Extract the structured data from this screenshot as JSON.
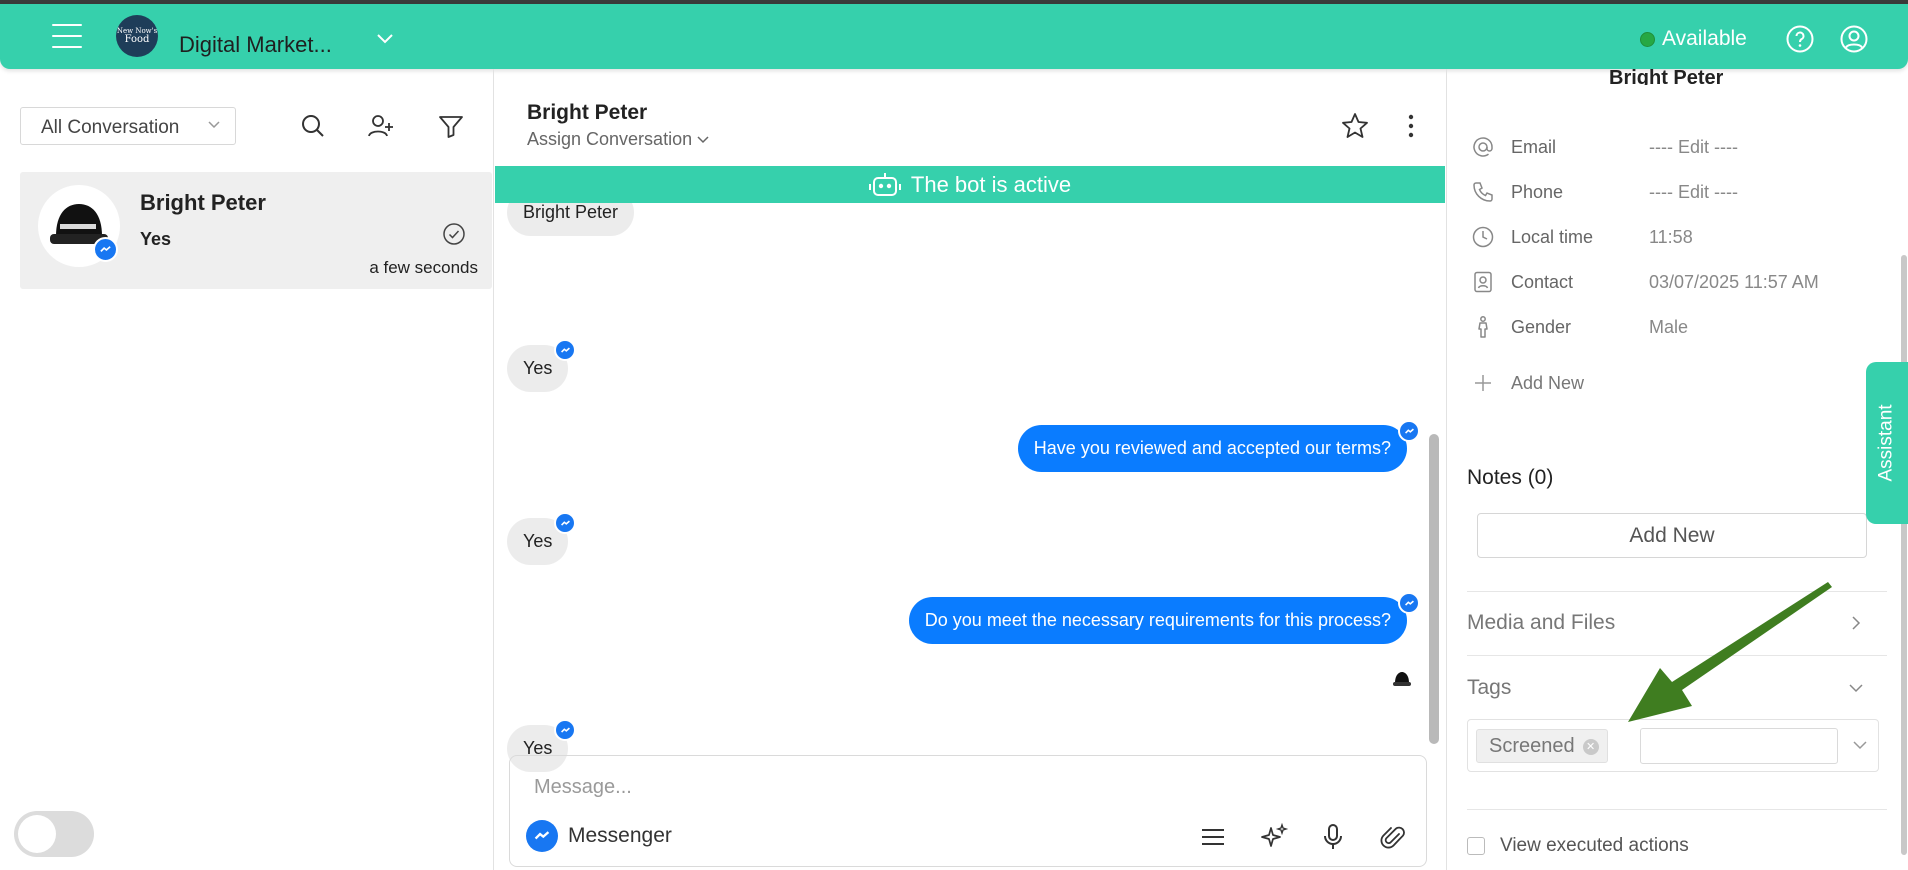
{
  "header": {
    "workspace_name": "Digital Market...",
    "logo_text_top": "New Now's",
    "logo_text_big": "Food",
    "status_label": "Available",
    "colors": {
      "header_bg": "#36d0ac",
      "status_dot": "#26a844"
    }
  },
  "left_panel": {
    "filter_value": "All Conversation",
    "conversation": {
      "name": "Bright Peter",
      "last_message": "Yes",
      "time": "a few seconds"
    }
  },
  "chat": {
    "contact_name": "Bright Peter",
    "assign_label": "Assign Conversation",
    "bot_banner": "The bot is active",
    "messages": [
      {
        "dir": "in",
        "text": "Bright Peter"
      },
      {
        "dir": "in",
        "text": "Yes"
      },
      {
        "dir": "out",
        "text": "Have you reviewed and accepted our terms?"
      },
      {
        "dir": "in",
        "text": "Yes"
      },
      {
        "dir": "out",
        "text": "Do you meet the necessary requirements for this process?"
      },
      {
        "dir": "in",
        "text": "Yes"
      }
    ],
    "composer": {
      "placeholder": "Message...",
      "channel": "Messenger"
    },
    "colors": {
      "outgoing_bubble": "#0a7cff",
      "incoming_bubble": "#ececec",
      "messenger": "#1877f2"
    }
  },
  "contact_panel": {
    "name": "Bright Peter",
    "fields": [
      {
        "icon": "at-icon",
        "label": "Email",
        "value": "---- Edit ----"
      },
      {
        "icon": "phone-icon",
        "label": "Phone",
        "value": "---- Edit ----"
      },
      {
        "icon": "clock-icon",
        "label": "Local time",
        "value": "11:58"
      },
      {
        "icon": "contact-card-icon",
        "label": "Contact",
        "value": "03/07/2025 11:57 AM"
      },
      {
        "icon": "gender-icon",
        "label": "Gender",
        "value": "Male"
      }
    ],
    "add_new_field": "Add New",
    "notes_title": "Notes (0)",
    "notes_add": "Add New",
    "media_title": "Media and Files",
    "tags_title": "Tags",
    "tags": [
      "Screened"
    ],
    "view_actions": "View executed actions",
    "assistant_tab": "Assistant"
  }
}
